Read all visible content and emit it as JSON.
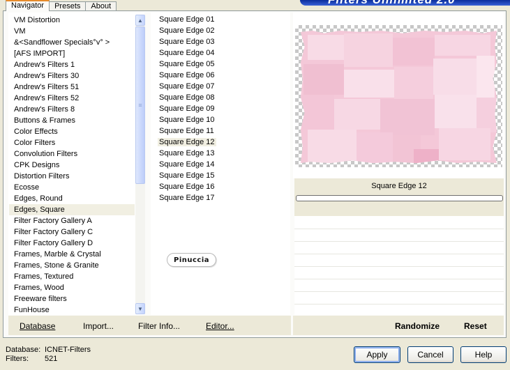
{
  "tabs": [
    {
      "label": "Navigator",
      "active": true
    },
    {
      "label": "Presets",
      "active": false
    },
    {
      "label": "About",
      "active": false
    }
  ],
  "banner": {
    "text": "Filters Unlimited 2.0"
  },
  "categories": {
    "items": [
      "VM Distortion",
      "VM",
      "&<Sandflower Specials°v° >",
      "[AFS IMPORT]",
      "Andrew's Filters 1",
      "Andrew's Filters 30",
      "Andrew's Filters 51",
      "Andrew's Filters 52",
      "Andrew's Filters 8",
      "Buttons & Frames",
      "Color Effects",
      "Color Filters",
      "Convolution Filters",
      "CPK Designs",
      "Distortion Filters",
      "Ecosse",
      "Edges, Round",
      "Edges, Square",
      "Filter Factory Gallery A",
      "Filter Factory Gallery C",
      "Filter Factory Gallery D",
      "Frames, Marble & Crystal",
      "Frames, Stone & Granite",
      "Frames, Textured",
      "Frames, Wood",
      "Freeware filters",
      "FunHouse"
    ],
    "selected_index": 17
  },
  "filters": {
    "items": [
      "Square Edge 01",
      "Square Edge 02",
      "Square Edge 03",
      "Square Edge 04",
      "Square Edge 05",
      "Square Edge 06",
      "Square Edge 07",
      "Square Edge 08",
      "Square Edge 09",
      "Square Edge 10",
      "Square Edge 11",
      "Square Edge 12",
      "Square Edge 13",
      "Square Edge 14",
      "Square Edge 15",
      "Square Edge 16",
      "Square Edge 17"
    ],
    "selected_index": 11
  },
  "watermark": {
    "text": "Pinuccia"
  },
  "preview": {
    "filter_name": "Square Edge 12",
    "progress": 0
  },
  "toolbar": {
    "database_label": "Database",
    "import_label": "Import...",
    "filter_info_label": "Filter Info...",
    "editor_label": "Editor...",
    "randomize_label": "Randomize",
    "reset_label": "Reset"
  },
  "status": {
    "database_key": "Database:",
    "database_value": "ICNET-Filters",
    "filters_key": "Filters:",
    "filters_value": "521"
  },
  "buttons": {
    "apply": "Apply",
    "cancel": "Cancel",
    "help": "Help"
  },
  "colors": {
    "accent_tab": "#e68b2c",
    "selection": "#f1efe2",
    "preview_pink": "#f4c8d8",
    "banner": "#0a2d9c"
  }
}
